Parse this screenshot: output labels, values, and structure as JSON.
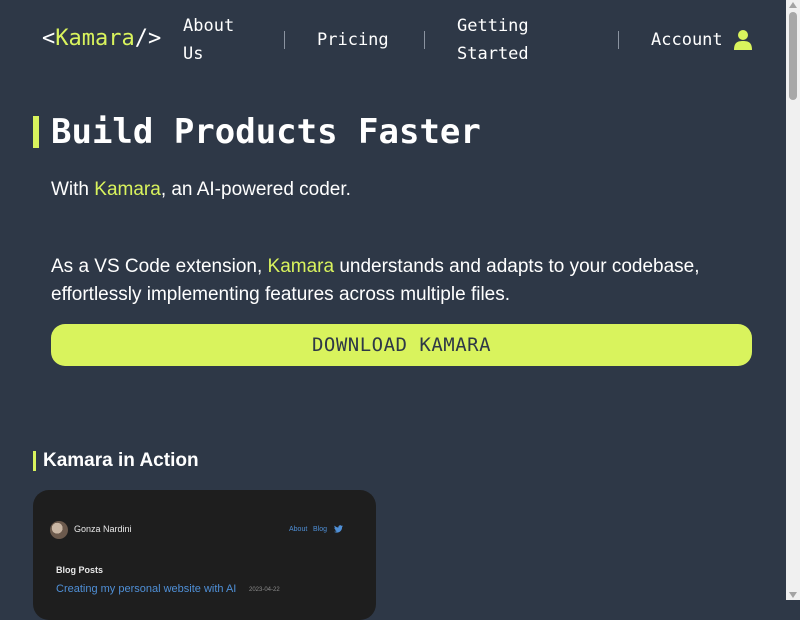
{
  "nav": {
    "logo_open": "<",
    "logo_name": "Kamara",
    "logo_close": "/>",
    "about_line1": "About",
    "about_line2": "Us",
    "pricing": "Pricing",
    "getting_line1": "Getting",
    "getting_line2": "Started",
    "account": "Account"
  },
  "hero": {
    "title": "Build Products Faster",
    "lead_prefix": "With ",
    "lead_highlight": "Kamara",
    "lead_suffix": ", an AI-powered coder.",
    "desc_prefix": "As a VS Code extension, ",
    "desc_highlight": "Kamara",
    "desc_suffix": " understands and adapts to your codebase, effortlessly implementing features across multiple files.",
    "download_label": "DOWNLOAD KAMARA"
  },
  "section": {
    "title": "Kamara in Action"
  },
  "preview": {
    "author": "Gonza Nardini",
    "link_about": "About",
    "link_blog": "Blog",
    "heading": "Blog Posts",
    "post_title": "Creating my personal website with AI",
    "post_date": "2023-04-22"
  },
  "colors": {
    "background": "#2e3847",
    "accent": "#d9f35d",
    "preview_bg": "#1e1e1e",
    "link_blue": "#4f8fd6"
  },
  "icons": {
    "account": "user-icon",
    "twitter": "twitter-icon"
  }
}
